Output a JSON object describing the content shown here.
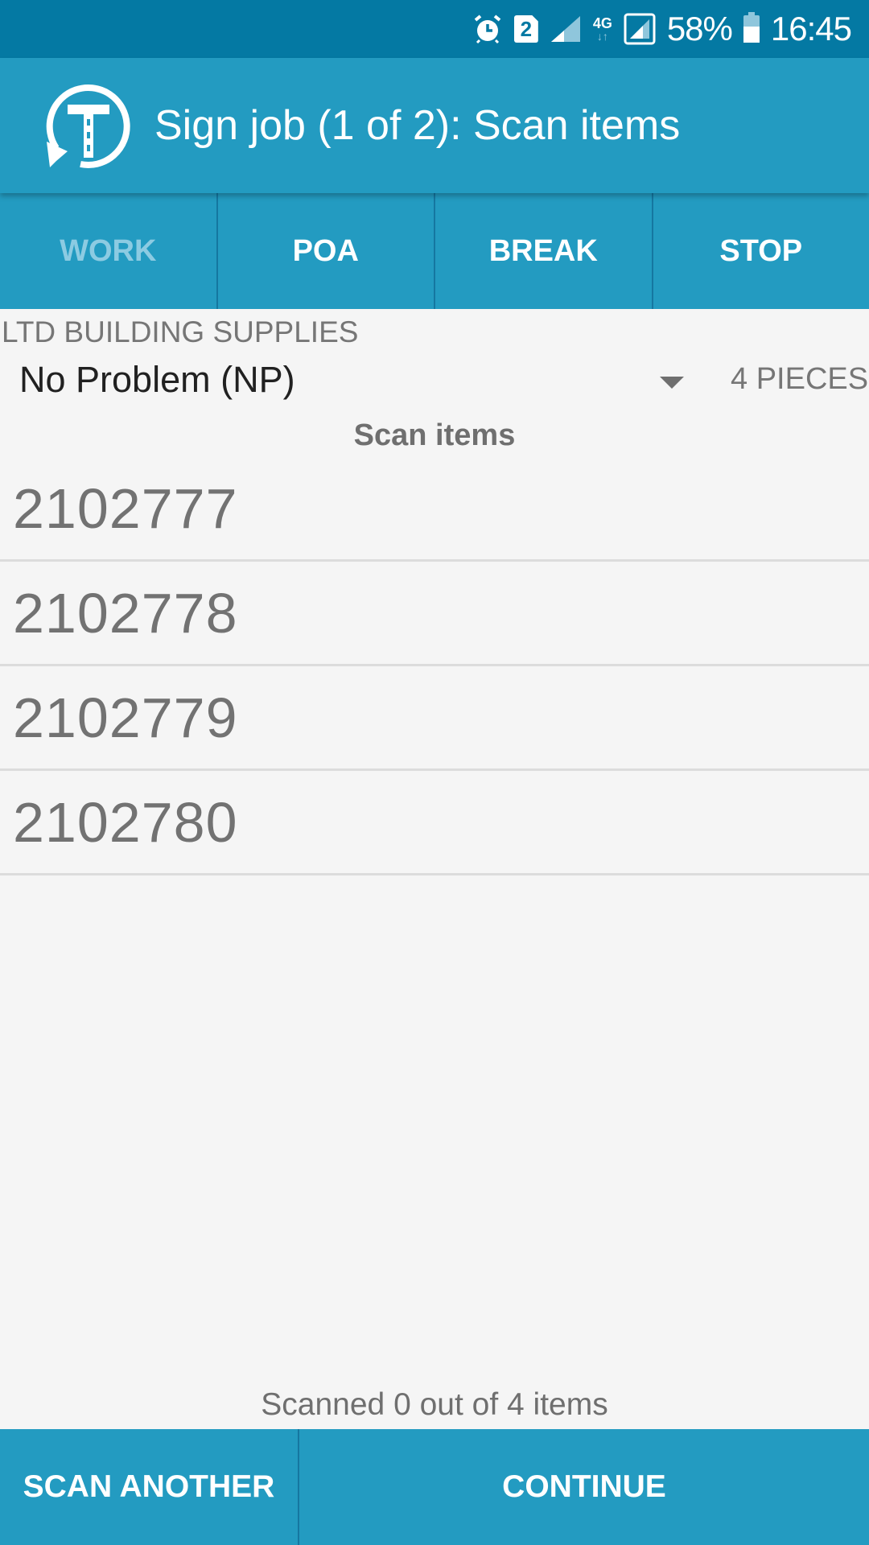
{
  "status_bar": {
    "icons": [
      "alarm-icon",
      "sim-2-icon",
      "signal-icon",
      "4g-data-icon",
      "signal-boxed-icon",
      "battery-icon"
    ],
    "sim_label": "2",
    "network_label": "4G",
    "network_arrows": "↓↑",
    "battery_percent": "58%",
    "battery_level": 0.58,
    "time": "16:45"
  },
  "app_bar": {
    "logo_icon": "t-cycle-logo-icon",
    "title": "Sign job (1 of 2): Scan items"
  },
  "tabs": [
    {
      "label": "WORK",
      "active": true
    },
    {
      "label": "POA",
      "active": false
    },
    {
      "label": "BREAK",
      "active": false
    },
    {
      "label": "STOP",
      "active": false
    }
  ],
  "job": {
    "customer": "LTD BUILDING SUPPLIES",
    "status_select": {
      "selected": "No Problem (NP)",
      "icon": "dropdown-arrow-icon"
    },
    "pieces": "4 PIECES"
  },
  "scan": {
    "section_title": "Scan items",
    "items": [
      "2102777",
      "2102778",
      "2102779",
      "2102780"
    ],
    "progress_text": "Scanned 0 out of 4 items",
    "scanned": 0,
    "total": 4
  },
  "footer": {
    "scan_another_label": "SCAN ANOTHER",
    "continue_label": "CONTINUE"
  },
  "colors": {
    "status_bar": "#0479a3",
    "primary": "#239bc1",
    "tab_divider": "#1577a0",
    "active_tab_text": "#8ccbe2",
    "background": "#f5f5f5",
    "secondary_text": "#767676"
  }
}
